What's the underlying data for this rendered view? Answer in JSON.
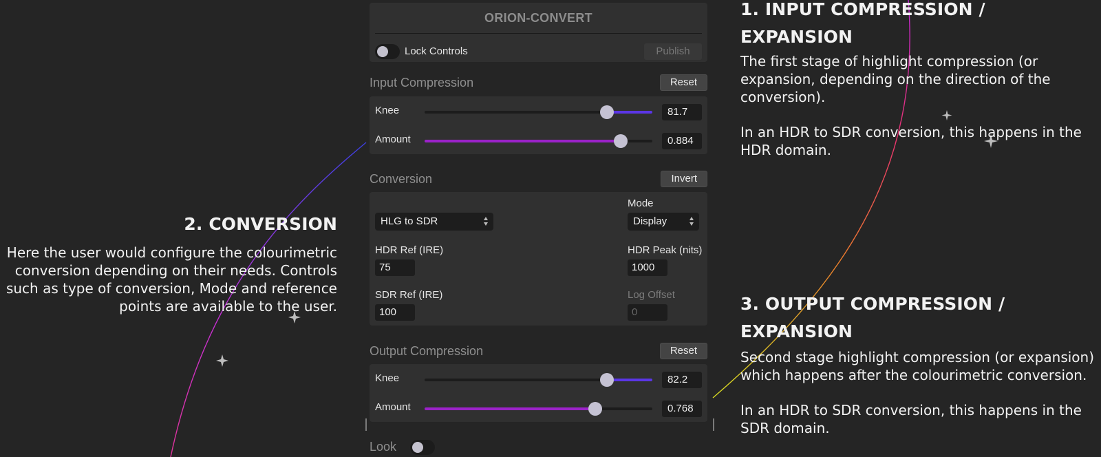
{
  "annotations": {
    "input": {
      "title": "1. INPUT COMPRESSION / EXPANSION",
      "p1": "The first stage of highlight compression (or expansion, depending on the direction of the conversion).",
      "p2": "In an HDR to SDR conversion, this happens in the HDR domain."
    },
    "conversion": {
      "title": "2. CONVERSION",
      "p1": "Here the user would configure the colourimetric conversion depending on their needs. Controls such as type of conversion, Mode and reference points are available to the user."
    },
    "output": {
      "title": "3. OUTPUT COMPRESSION / EXPANSION",
      "p1": "Second stage highlight compression (or expansion) which happens after the colourimetric conversion.",
      "p2": "In an HDR to SDR conversion, this happens in the SDR domain."
    }
  },
  "panel": {
    "title": "ORION-CONVERT",
    "lock_label": "Lock Controls",
    "publish_label": "Publish",
    "input_compression": {
      "title": "Input Compression",
      "reset_label": "Reset",
      "knee": {
        "label": "Knee",
        "value": "81.7",
        "fraction": 0.8,
        "fill_side": "right",
        "color": "#5b36e6"
      },
      "amount": {
        "label": "Amount",
        "value": "0.884",
        "fraction": 0.86,
        "fill_side": "left",
        "color": "#9b22c8"
      }
    },
    "conversion": {
      "title": "Conversion",
      "invert_label": "Invert",
      "type_value": "HLG to SDR",
      "mode_label": "Mode",
      "mode_value": "Display",
      "hdr_ref_label": "HDR Ref (IRE)",
      "hdr_ref_value": "75",
      "hdr_peak_label": "HDR Peak (nits)",
      "hdr_peak_value": "1000",
      "sdr_ref_label": "SDR Ref (IRE)",
      "sdr_ref_value": "100",
      "log_offset_label": "Log Offset",
      "log_offset_value": "0"
    },
    "output_compression": {
      "title": "Output Compression",
      "reset_label": "Reset",
      "knee": {
        "label": "Knee",
        "value": "82.2",
        "fraction": 0.8,
        "fill_side": "right",
        "color": "#5b36e6"
      },
      "amount": {
        "label": "Amount",
        "value": "0.768",
        "fraction": 0.75,
        "fill_side": "left",
        "color": "#9b22c8"
      }
    },
    "look_label": "Look"
  },
  "colors": {
    "background": "#252525",
    "card": "#303030",
    "accent_blue": "#5b36e6",
    "accent_purple": "#9b22c8"
  }
}
